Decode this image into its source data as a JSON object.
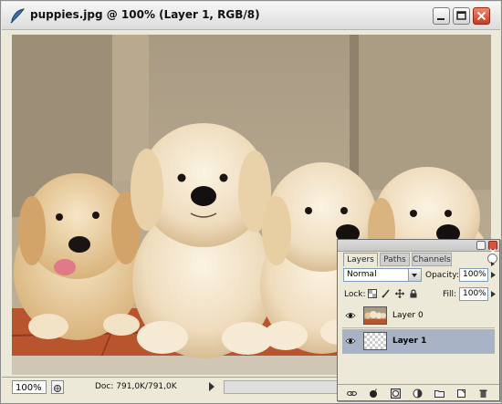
{
  "window": {
    "title": "puppies.jpg @ 100% (Layer 1, RGB/8)",
    "buttons": [
      "minimize",
      "maximize",
      "close"
    ]
  },
  "statusbar": {
    "zoom": "100%",
    "doc_info": "Doc: 791,0K/791,0K"
  },
  "layers_panel": {
    "tabs": [
      {
        "label": "Layers",
        "active": true
      },
      {
        "label": "Paths",
        "active": false
      },
      {
        "label": "Channels",
        "active": false
      }
    ],
    "blend_mode": "Normal",
    "opacity_label": "Opacity:",
    "opacity_value": "100%",
    "lock_label": "Lock:",
    "fill_label": "Fill:",
    "fill_value": "100%",
    "layers": [
      {
        "name": "Layer 0",
        "visible": true,
        "selected": false,
        "thumbnail": "puppies-photo"
      },
      {
        "name": "Layer 1",
        "visible": true,
        "selected": true,
        "thumbnail": "transparent"
      }
    ],
    "footer_icons": [
      "link-icon",
      "layer-style-icon",
      "layer-mask-icon",
      "adjustment-layer-icon",
      "new-group-icon",
      "new-layer-icon",
      "trash-icon"
    ]
  },
  "colors": {
    "title_close": "#c9391e",
    "selected_layer": "#a8b4c6",
    "wall": "#b7a78e",
    "floor": "#b8552e"
  }
}
